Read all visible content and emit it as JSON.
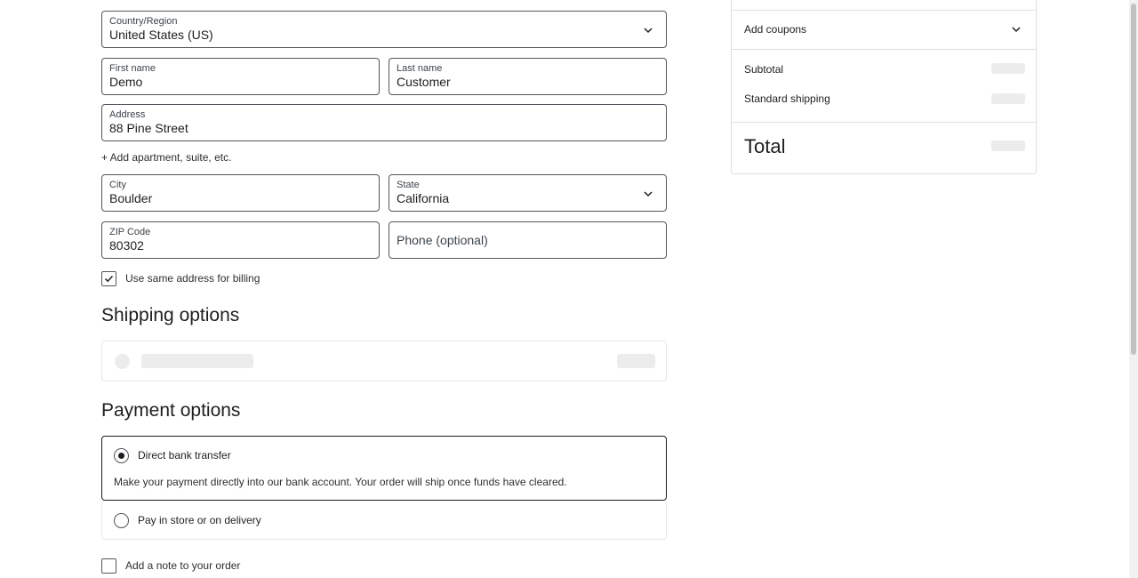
{
  "address": {
    "country": {
      "label": "Country/Region",
      "value": "United States (US)"
    },
    "first_name": {
      "label": "First name",
      "value": "Demo"
    },
    "last_name": {
      "label": "Last name",
      "value": "Customer"
    },
    "street": {
      "label": "Address",
      "value": "88 Pine Street"
    },
    "add_apartment": "+ Add apartment, suite, etc.",
    "city": {
      "label": "City",
      "value": "Boulder"
    },
    "state": {
      "label": "State",
      "value": "California"
    },
    "zip": {
      "label": "ZIP Code",
      "value": "80302"
    },
    "phone": {
      "placeholder": "Phone (optional)"
    },
    "same_billing": {
      "label": "Use same address for billing",
      "checked": true
    }
  },
  "shipping": {
    "heading": "Shipping options"
  },
  "payment": {
    "heading": "Payment options",
    "options": [
      {
        "label": "Direct bank transfer",
        "selected": true,
        "description": "Make your payment directly into our bank account. Your order will ship once funds have cleared."
      },
      {
        "label": "Pay in store or on delivery",
        "selected": false
      }
    ],
    "add_note": "Add a note to your order"
  },
  "summary": {
    "coupons": "Add coupons",
    "subtotal": "Subtotal",
    "shipping": "Standard shipping",
    "total": "Total"
  },
  "colors": {
    "border": "#50575e",
    "skeleton": "#ececec",
    "text": "#1e1e1e"
  }
}
